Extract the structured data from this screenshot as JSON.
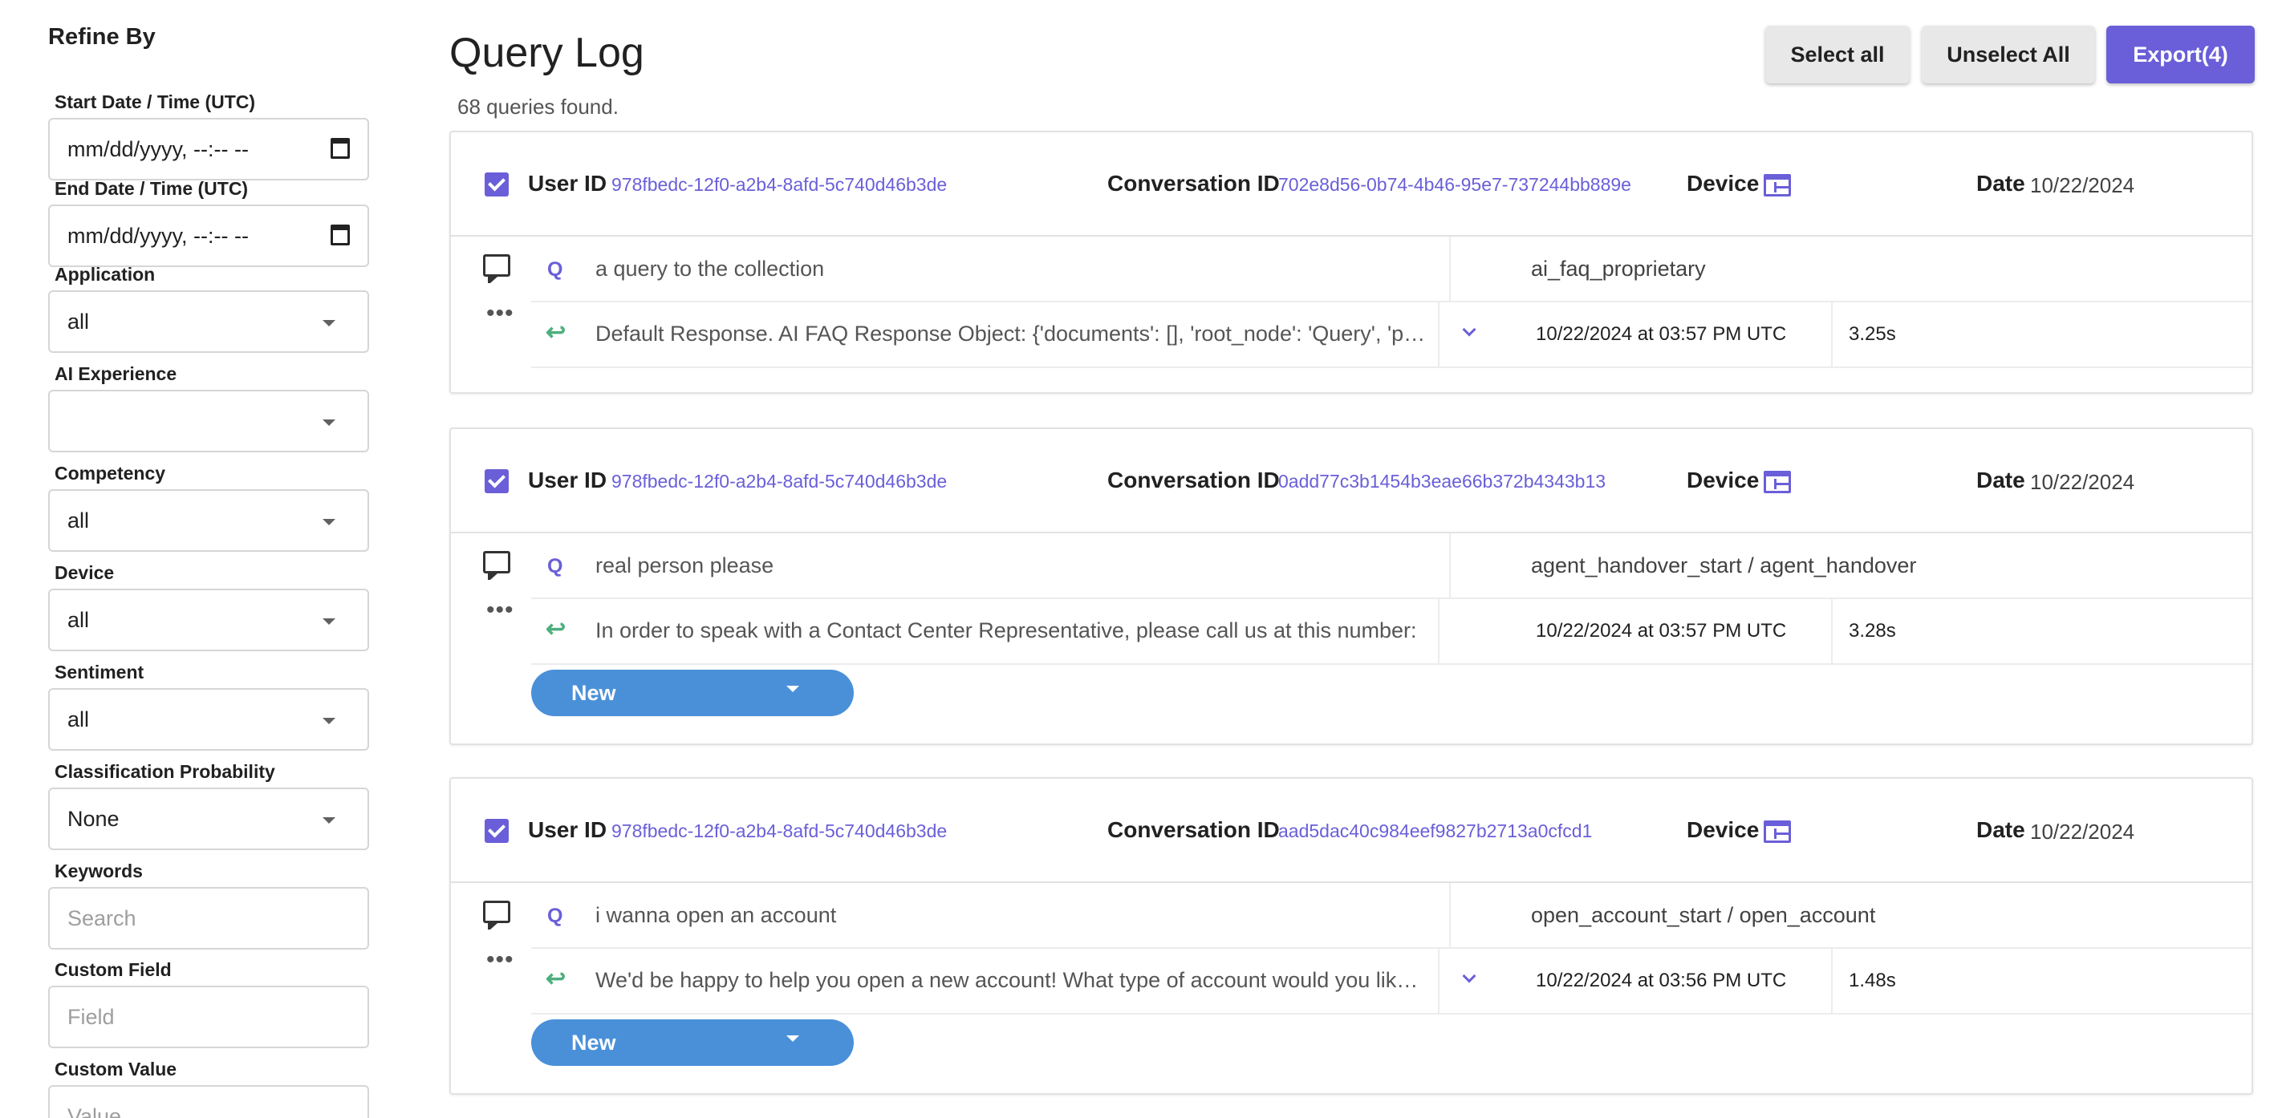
{
  "sidebar": {
    "title": "Refine By",
    "filters": {
      "start_date": {
        "label": "Start Date / Time (UTC)",
        "value": "mm/dd/yyyy, --:-- --"
      },
      "end_date": {
        "label": "End Date / Time (UTC)",
        "value": "mm/dd/yyyy, --:-- --"
      },
      "application": {
        "label": "Application",
        "value": "all"
      },
      "ai_experience": {
        "label": "AI Experience",
        "value": ""
      },
      "competency": {
        "label": "Competency",
        "value": "all"
      },
      "device": {
        "label": "Device",
        "value": "all"
      },
      "sentiment": {
        "label": "Sentiment",
        "value": "all"
      },
      "classification_probability": {
        "label": "Classification Probability",
        "value": "None"
      },
      "keywords": {
        "label": "Keywords",
        "placeholder": "Search"
      },
      "custom_field": {
        "label": "Custom Field",
        "placeholder": "Field"
      },
      "custom_value": {
        "label": "Custom Value",
        "placeholder": "Value"
      }
    }
  },
  "header": {
    "title": "Query Log",
    "count_text": "68 queries found.",
    "select_all_label": "Select all",
    "unselect_all_label": "Unselect All",
    "export_label": "Export(4)"
  },
  "labels": {
    "user_id": "User ID",
    "conversation_id": "Conversation ID",
    "device": "Device",
    "date": "Date",
    "q": "Q"
  },
  "colors": {
    "accent": "#6a5fd8",
    "status_button": "#4a90d9",
    "reply_icon": "#4caf7d"
  },
  "queries": [
    {
      "checked": true,
      "user_id": "978fbedc-12f0-a2b4-8afd-5c740d46b3de",
      "conversation_id": "702e8d56-0b74-4b46-95e7-737244bb889e",
      "device_icon": "browser-icon",
      "date": "10/22/2024",
      "question": "a query to the collection",
      "intent": "ai_faq_proprietary",
      "answer": "Default Response. AI FAQ Response Object: {'documents': [], 'root_node': 'Query', 'parameters': {}}",
      "timestamp": "10/22/2024 at 03:57 PM UTC",
      "duration": "3.25s",
      "status": ""
    },
    {
      "checked": true,
      "user_id": "978fbedc-12f0-a2b4-8afd-5c740d46b3de",
      "conversation_id": "0add77c3b1454b3eae66b372b4343b13",
      "device_icon": "browser-icon",
      "date": "10/22/2024",
      "question": "real person please",
      "intent": "agent_handover_start / agent_handover",
      "answer": "In order to speak with a Contact Center Representative, please call us at this number:",
      "timestamp": "10/22/2024 at 03:57 PM UTC",
      "duration": "3.28s",
      "status": "New"
    },
    {
      "checked": true,
      "user_id": "978fbedc-12f0-a2b4-8afd-5c740d46b3de",
      "conversation_id": "aad5dac40c984eef9827b2713a0cfcd1",
      "device_icon": "browser-icon",
      "date": "10/22/2024",
      "question": "i wanna open an account",
      "intent": "open_account_start / open_account",
      "answer": "We'd be happy to help you open a new account! What type of account would you like to open?",
      "timestamp": "10/22/2024 at 03:56 PM UTC",
      "duration": "1.48s",
      "status": "New"
    }
  ]
}
